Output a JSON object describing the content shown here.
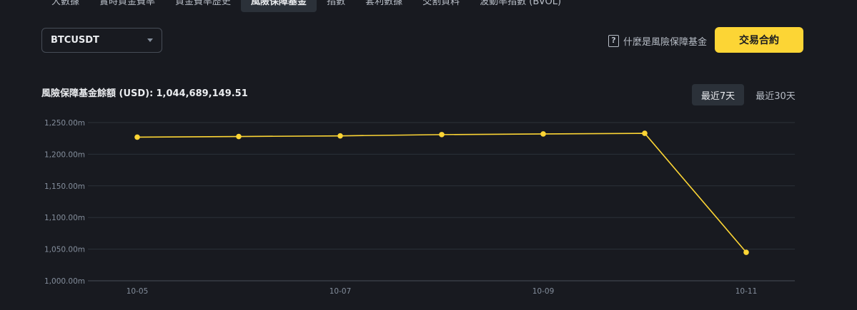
{
  "tabs": [
    {
      "label": "大數據"
    },
    {
      "label": "實時資金費率"
    },
    {
      "label": "資金費率歷史"
    },
    {
      "label": "風險保障基金"
    },
    {
      "label": "指數"
    },
    {
      "label": "套利數據"
    },
    {
      "label": "交割資料"
    },
    {
      "label": "波動率指數 (BVOL)"
    }
  ],
  "active_tab": "風險保障基金",
  "symbol": {
    "value": "BTCUSDT"
  },
  "help": {
    "icon": "question-book-icon",
    "label": "什麼是風險保障基金"
  },
  "trade_button": {
    "label": "交易合約"
  },
  "balance": {
    "label": "風險保障基金餘額 (USD):",
    "value": "1,044,689,149.51"
  },
  "range": {
    "r7": "最近7天",
    "r30": "最近30天",
    "selected": "r7"
  },
  "colors": {
    "accent": "#fcd535",
    "background": "#181a20",
    "grid": "#2b3139"
  },
  "chart_data": {
    "type": "line",
    "x": [
      "10-05",
      "10-06",
      "10-07",
      "10-08",
      "10-09",
      "10-10",
      "10-11"
    ],
    "x_tick_labels": [
      "10-05",
      "10-07",
      "10-09",
      "10-11"
    ],
    "y_tick_labels": [
      "1,250.00m",
      "1,200.00m",
      "1,150.00m",
      "1,100.00m",
      "1,050.00m",
      "1,000.00m"
    ],
    "y_ticks": [
      1250,
      1200,
      1150,
      1100,
      1050,
      1000
    ],
    "ylim": [
      1000,
      1250
    ],
    "series": [
      {
        "values": [
          1227,
          1228,
          1229,
          1231,
          1232,
          1233,
          1045
        ],
        "color": "#fcd535"
      }
    ],
    "grid": true
  }
}
